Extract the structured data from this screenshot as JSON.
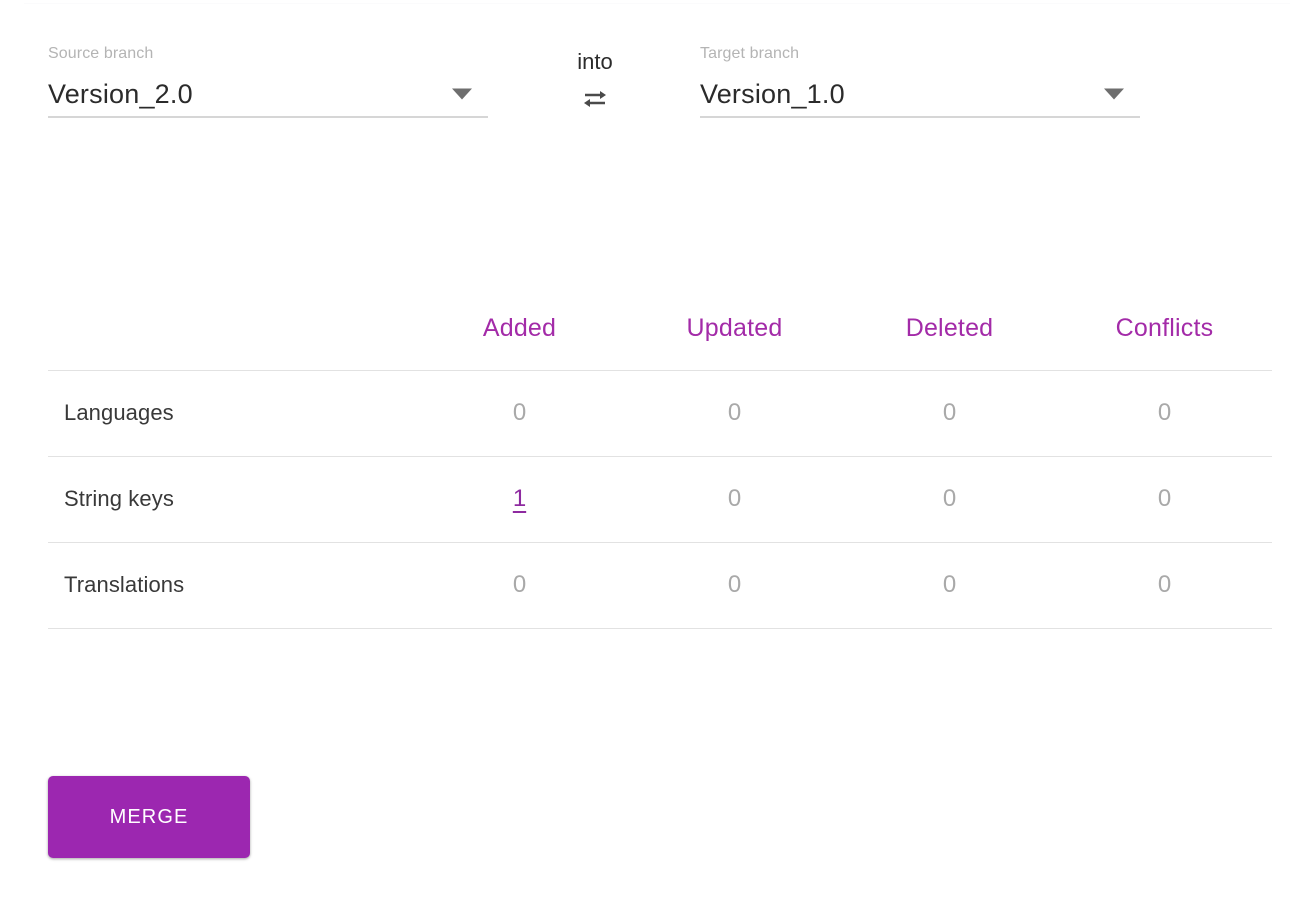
{
  "branches": {
    "source": {
      "label": "Source branch",
      "value": "Version_2.0",
      "caret_icon": "chevron-down-icon"
    },
    "target": {
      "label": "Target branch",
      "value": "Version_1.0",
      "caret_icon": "chevron-down-icon"
    },
    "connector_word": "into",
    "swap_icon": "swap-horizontal-icon"
  },
  "diff_table": {
    "row_header": "",
    "columns": [
      "Added",
      "Updated",
      "Deleted",
      "Conflicts"
    ],
    "rows": [
      {
        "name": "Languages",
        "values": [
          "0",
          "0",
          "0",
          "0"
        ],
        "links": [
          false,
          false,
          false,
          false
        ]
      },
      {
        "name": "String keys",
        "values": [
          "1",
          "0",
          "0",
          "0"
        ],
        "links": [
          true,
          false,
          false,
          false
        ]
      },
      {
        "name": "Translations",
        "values": [
          "0",
          "0",
          "0",
          "0"
        ],
        "links": [
          false,
          false,
          false,
          false
        ]
      }
    ]
  },
  "actions": {
    "merge_label": "MERGE"
  },
  "colors": {
    "accent_purple": "#9c27b0",
    "header_purple": "#a32ba8",
    "link_purple": "#8e2aa0",
    "muted_value": "#a9a9a9",
    "label_gray": "#b4b4b4",
    "divider": "#e2e2e2"
  }
}
